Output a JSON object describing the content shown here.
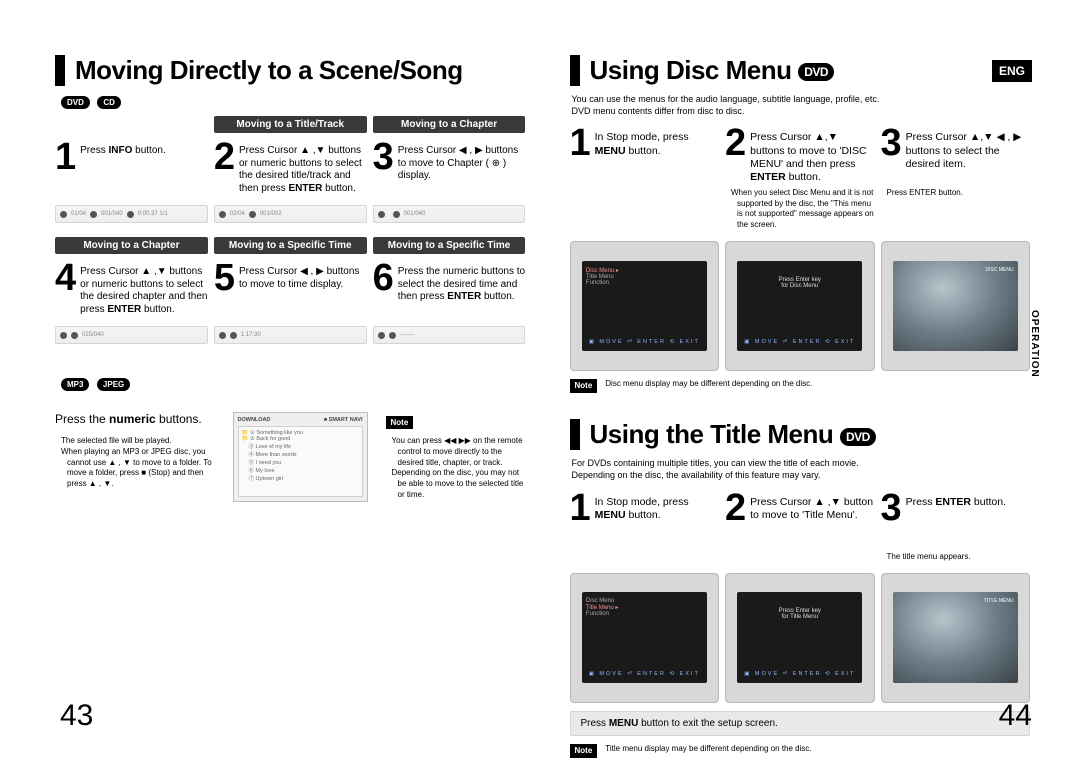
{
  "lang_badge": "ENG",
  "side_tab": "OPERATION",
  "left": {
    "title": "Moving Directly to a Scene/Song",
    "badges": [
      "DVD",
      "CD"
    ],
    "rowA": {
      "headers": [
        "",
        "Moving to a Title/Track",
        "Moving to a Chapter"
      ],
      "steps": [
        {
          "n": "1",
          "text": "Press <b>INFO</b> button."
        },
        {
          "n": "2",
          "text": "Press Cursor ▲ ,▼ buttons or numeric buttons to select the desired title/track and then press <b>ENTER</b> button.",
          "cls": "small"
        },
        {
          "n": "3",
          "text": "Press Cursor ◀ , ▶ buttons to move to Chapter ( ⊕ ) display."
        }
      ]
    },
    "rowB": {
      "headers": [
        "Moving to a Chapter",
        "Moving to a Specific Time",
        "Moving to a Specific Time"
      ],
      "steps": [
        {
          "n": "4",
          "text": "Press Cursor ▲ ,▼ buttons or numeric buttons to select the desired chapter and then press <b>ENTER</b> button.",
          "cls": "small"
        },
        {
          "n": "5",
          "text": "Press Cursor ◀ , ▶ buttons to move to time display."
        },
        {
          "n": "6",
          "text": "Press the numeric buttons to select the desired time and then press <b>ENTER</b> button."
        }
      ]
    },
    "mp3": {
      "badges": [
        "MP3",
        "JPEG"
      ],
      "instr": "Press the <b>numeric</b> buttons.",
      "bullets": [
        "The selected file will be played.",
        "When playing an MP3 or JPEG disc, you cannot use ▲ , ▼ to move to a folder. To move a folder, press ■ (Stop) and then press ▲ , ▼."
      ],
      "window": {
        "title_left": "DOWNLOAD",
        "title_right": "■ SMART NAVI",
        "items": [
          "Something like you",
          "Back for good",
          "Love of my life",
          "More than words",
          "I need you",
          "My love",
          "Uptown girl"
        ]
      },
      "noteLabel": "Note",
      "noteBullets": [
        "You can press ◀◀ ▶▶ on the remote control to move directly to the desired title, chapter, or track.",
        "Depending on the disc, you may not be able to move to the selected title or time."
      ]
    },
    "pageNum": "43"
  },
  "right": {
    "disc": {
      "title": "Using Disc Menu",
      "badge": "DVD",
      "sub": "You can use the menus for the audio language, subtitle language, profile, etc.\nDVD menu contents differ from disc to disc.",
      "steps": [
        {
          "n": "1",
          "text": "In Stop mode, press <b>MENU</b> button."
        },
        {
          "n": "2",
          "text": "Press Cursor ▲,▼ buttons to move to 'DISC MENU' and then press <b>ENTER</b> button."
        },
        {
          "n": "3",
          "text": "Press Cursor ▲,▼ ◀ , ▶ buttons to select the desired item."
        }
      ],
      "tvnotes": [
        "When you select Disc Menu and it is not supported by the disc, the \"This menu is not supported\" message appears on the screen.",
        "Press ENTER button."
      ],
      "noteLabel": "Note",
      "note": "Disc menu display may be different depending on the disc."
    },
    "titleMenu": {
      "title": "Using the Title Menu",
      "badge": "DVD",
      "sub": "For DVDs containing multiple titles, you can view the title of each movie.\nDepending on the disc, the availability of this feature may vary.",
      "steps": [
        {
          "n": "1",
          "text": "In Stop mode, press <b>MENU</b> button."
        },
        {
          "n": "2",
          "text": "Press Cursor ▲ ,▼ button to move to 'Title Menu'."
        },
        {
          "n": "3",
          "text": "Press <b>ENTER</b> button."
        }
      ],
      "tvnotes3": "The title menu appears.",
      "bar": "Press <b>MENU</b> button to exit the setup screen.",
      "noteLabel": "Note",
      "note": "Title menu display may be different depending on the disc."
    },
    "pageNum": "44"
  }
}
